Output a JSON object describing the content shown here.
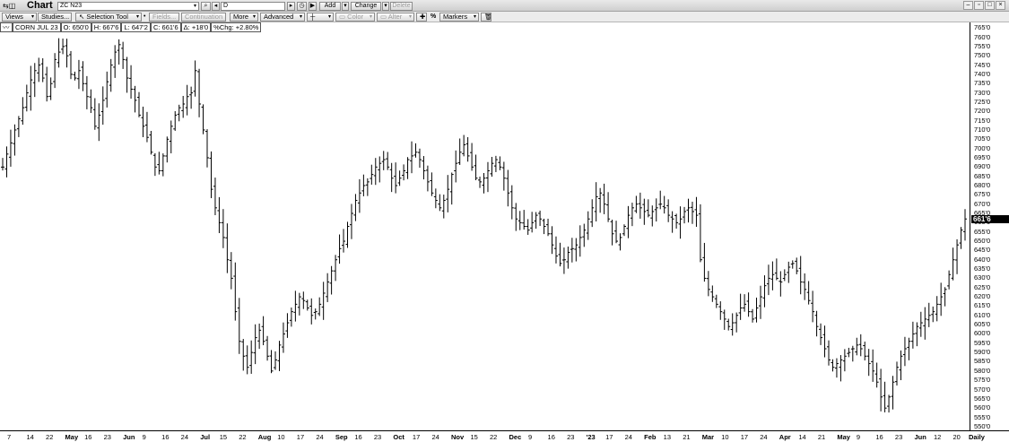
{
  "window": {
    "title": "Chart",
    "symbol": "ZC N23",
    "interval": "D",
    "add_label": "Add",
    "change_label": "Change",
    "delete_label": "Delete"
  },
  "toolbar": {
    "views": "Views",
    "studies": "Studies...",
    "selection_tool": "Selection Tool",
    "fields": "Fields...",
    "continuation": "Continuation",
    "more": "More",
    "advanced": "Advanced",
    "color": "Color",
    "alter": "Alter",
    "percent": "%",
    "markers": "Markers"
  },
  "info": {
    "name": "CORN JUL 23",
    "open": "O: 650'0",
    "high": "H: 667'6",
    "low": "L: 647'2",
    "close": "C: 661'6",
    "delta": "Δ: +18'0",
    "pct": "%Chg: +2.80%"
  },
  "chart_data": {
    "type": "ohlc",
    "last_price_label": "661'6",
    "y_ticks": [
      "765'0",
      "760'0",
      "755'0",
      "750'0",
      "745'0",
      "740'0",
      "735'0",
      "730'0",
      "725'0",
      "720'0",
      "715'0",
      "710'0",
      "705'0",
      "700'0",
      "695'0",
      "690'0",
      "685'0",
      "680'0",
      "675'0",
      "670'0",
      "665'0",
      "660'0",
      "655'0",
      "650'0",
      "645'0",
      "640'0",
      "635'0",
      "630'0",
      "625'0",
      "620'0",
      "615'0",
      "610'0",
      "605'0",
      "600'0",
      "595'0",
      "590'0",
      "585'0",
      "580'0",
      "575'0",
      "570'0",
      "565'0",
      "560'0",
      "555'0",
      "550'0"
    ],
    "ylim": [
      548,
      768
    ],
    "last_price": 661.75,
    "x_labels": [
      {
        "t": "7",
        "b": false
      },
      {
        "t": "14",
        "b": false
      },
      {
        "t": "22",
        "b": false
      },
      {
        "t": "May",
        "b": true
      },
      {
        "t": "16",
        "b": false
      },
      {
        "t": "23",
        "b": false
      },
      {
        "t": "Jun",
        "b": true
      },
      {
        "t": "9",
        "b": false
      },
      {
        "t": "16",
        "b": false
      },
      {
        "t": "24",
        "b": false
      },
      {
        "t": "Jul",
        "b": true
      },
      {
        "t": "15",
        "b": false
      },
      {
        "t": "22",
        "b": false
      },
      {
        "t": "Aug",
        "b": true
      },
      {
        "t": "10",
        "b": false
      },
      {
        "t": "17",
        "b": false
      },
      {
        "t": "24",
        "b": false
      },
      {
        "t": "Sep",
        "b": true
      },
      {
        "t": "16",
        "b": false
      },
      {
        "t": "23",
        "b": false
      },
      {
        "t": "Oct",
        "b": true
      },
      {
        "t": "17",
        "b": false
      },
      {
        "t": "24",
        "b": false
      },
      {
        "t": "Nov",
        "b": true
      },
      {
        "t": "15",
        "b": false
      },
      {
        "t": "22",
        "b": false
      },
      {
        "t": "Dec",
        "b": true
      },
      {
        "t": "9",
        "b": false
      },
      {
        "t": "16",
        "b": false
      },
      {
        "t": "23",
        "b": false
      },
      {
        "t": "'23",
        "b": true
      },
      {
        "t": "17",
        "b": false
      },
      {
        "t": "24",
        "b": false
      },
      {
        "t": "Feb",
        "b": true
      },
      {
        "t": "13",
        "b": false
      },
      {
        "t": "21",
        "b": false
      },
      {
        "t": "Mar",
        "b": true
      },
      {
        "t": "10",
        "b": false
      },
      {
        "t": "17",
        "b": false
      },
      {
        "t": "24",
        "b": false
      },
      {
        "t": "Apr",
        "b": true
      },
      {
        "t": "14",
        "b": false
      },
      {
        "t": "21",
        "b": false
      },
      {
        "t": "May",
        "b": true
      },
      {
        "t": "9",
        "b": false
      },
      {
        "t": "16",
        "b": false
      },
      {
        "t": "23",
        "b": false
      },
      {
        "t": "Jun",
        "b": true
      },
      {
        "t": "12",
        "b": false
      },
      {
        "t": "20",
        "b": false
      },
      {
        "t": "Daily",
        "b": true
      }
    ],
    "closes": [
      690,
      697,
      703,
      710,
      716,
      722,
      730,
      737,
      742,
      745,
      738,
      728,
      735,
      748,
      752,
      755,
      750,
      740,
      738,
      742,
      735,
      728,
      722,
      712,
      718,
      726,
      736,
      745,
      752,
      756,
      748,
      738,
      732,
      726,
      718,
      712,
      706,
      698,
      690,
      688,
      696,
      705,
      712,
      718,
      722,
      724,
      728,
      730,
      742,
      724,
      710,
      695,
      678,
      668,
      660,
      652,
      640,
      630,
      612,
      596,
      588,
      582,
      590,
      598,
      602,
      596,
      588,
      580,
      586,
      594,
      600,
      606,
      612,
      616,
      620,
      618,
      614,
      610,
      612,
      616,
      622,
      628,
      634,
      640,
      646,
      650,
      658,
      665,
      672,
      676,
      680,
      682,
      686,
      690,
      692,
      694,
      690,
      684,
      680,
      684,
      688,
      694,
      696,
      698,
      694,
      688,
      682,
      676,
      672,
      668,
      672,
      678,
      686,
      692,
      698,
      702,
      696,
      690,
      684,
      682,
      684,
      688,
      692,
      694,
      690,
      684,
      676,
      668,
      662,
      660,
      658,
      656,
      660,
      664,
      662,
      658,
      654,
      648,
      642,
      638,
      640,
      644,
      646,
      648,
      652,
      656,
      662,
      668,
      674,
      676,
      670,
      662,
      654,
      650,
      652,
      658,
      664,
      668,
      670,
      668,
      666,
      664,
      666,
      668,
      670,
      668,
      664,
      662,
      660,
      662,
      666,
      668,
      666,
      664,
      640,
      630,
      624,
      620,
      616,
      612,
      608,
      604,
      606,
      610,
      614,
      616,
      612,
      608,
      614,
      620,
      626,
      630,
      632,
      630,
      628,
      632,
      636,
      638,
      634,
      628,
      624,
      618,
      612,
      604,
      598,
      592,
      586,
      582,
      584,
      586,
      588,
      590,
      592,
      594,
      592,
      588,
      584,
      580,
      574,
      566,
      560,
      566,
      574,
      582,
      588,
      592,
      596,
      600,
      604,
      606,
      608,
      610,
      612,
      616,
      620,
      624,
      632,
      640,
      648,
      656,
      662
    ]
  }
}
